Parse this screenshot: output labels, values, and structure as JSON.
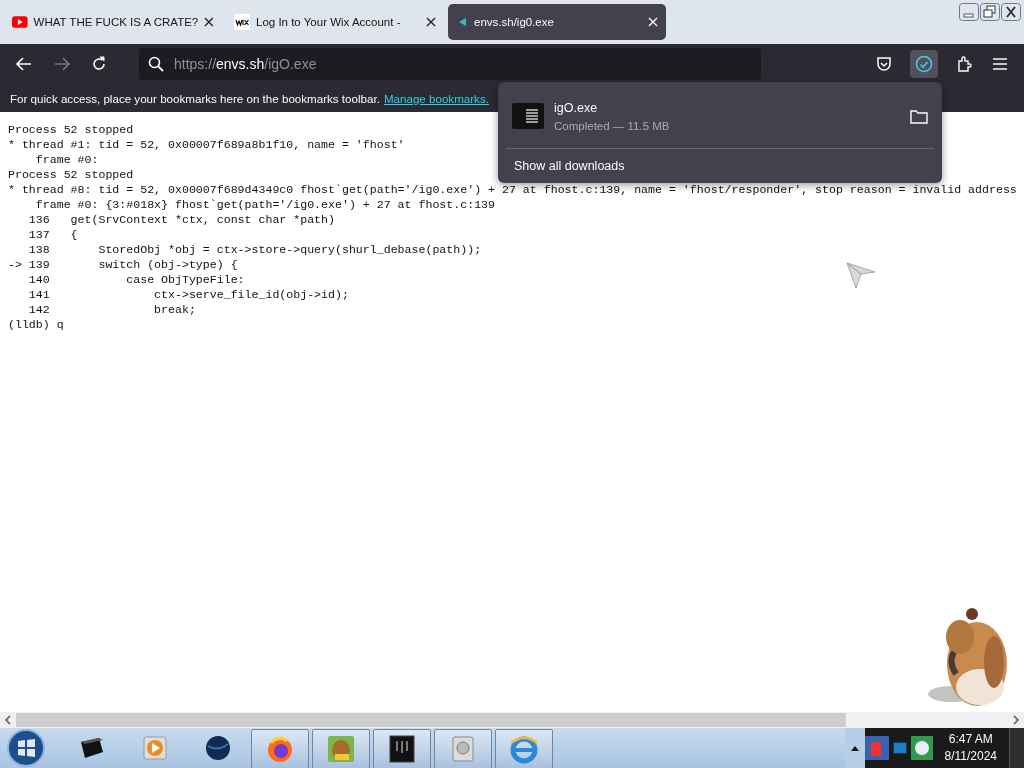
{
  "tabs": [
    {
      "title": "WHAT THE FUCK IS A CRATE?",
      "kind": "video",
      "selected": false
    },
    {
      "title": "Log In to Your Wix Account -",
      "kind": "wix",
      "selected": false
    },
    {
      "title": "envs.sh/ig0.exe",
      "kind": "site",
      "selected": true
    }
  ],
  "address_bar": {
    "parts": [
      {
        "text": "https://",
        "strong": false
      },
      {
        "text": "envs.sh",
        "strong": true
      },
      {
        "text": "/igO.exe",
        "strong": false
      }
    ]
  },
  "toolbar": {
    "downloads_active": true
  },
  "bookmarks_bar": {
    "message": "For quick access, place your bookmarks here on the bookmarks toolbar.",
    "link": "Manage bookmarks."
  },
  "terminal": {
    "lines": [
      "Process 52 stopped",
      "* thread #1: tid = 52, 0x00007f689a8b1f10, name = 'fhost'",
      "    frame #0:",
      "Process 52 stopped",
      "* thread #8: tid = 52, 0x00007f689d4349c0 fhost`get(path='/ig0.exe') + 27 at fhost.c:139, name = 'fhost/responder', stop reason = invalid address",
      "    frame #0: {3:#018x} fhost`get(path='/ig0.exe') + 27 at fhost.c:139",
      "   136   get(SrvContext *ctx, const char *path)",
      "   137   {",
      "   138       StoredObj *obj = ctx->store->query(shurl_debase(path));",
      "-> 139       switch (obj->type) {",
      "   140           case ObjTypeFile:",
      "   141               ctx->serve_file_id(obj->id);",
      "   142               break;",
      "(lldb) q"
    ]
  },
  "downloads_panel": {
    "items": [
      {
        "filename": "igO.exe",
        "status": "Completed — 11.5 MB"
      }
    ],
    "show_all": "Show all downloads"
  },
  "taskbar": {
    "apps": [
      {
        "kind": "terminal",
        "running": false
      },
      {
        "kind": "player",
        "running": false
      },
      {
        "kind": "globe",
        "running": false
      },
      {
        "kind": "firefox",
        "running": true
      },
      {
        "kind": "game",
        "running": true
      },
      {
        "kind": "dark-window",
        "running": true
      },
      {
        "kind": "drive",
        "running": true
      },
      {
        "kind": "ie",
        "running": true
      }
    ],
    "clock": {
      "time": "6:47 AM",
      "date": "8/11/2024"
    }
  }
}
